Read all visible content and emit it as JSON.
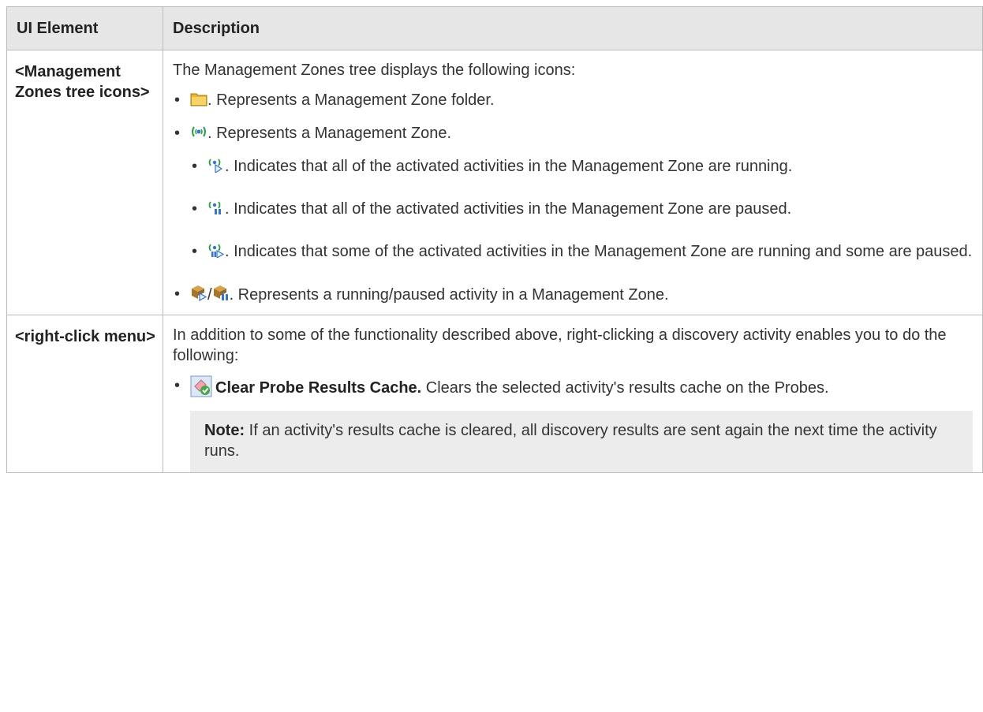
{
  "table": {
    "headers": {
      "element": "UI Element",
      "description": "Description"
    },
    "row1": {
      "element": "<Management Zones tree icons>",
      "intro": "The Management Zones tree displays the following icons:",
      "folder_text": ". Represents a Management Zone folder.",
      "zone_text": ". Represents a Management Zone.",
      "running_text": ". Indicates that all of the activated activities in the Management Zone are running.",
      "paused_text": ". Indicates that all of the activated activities in the Management Zone are paused.",
      "mixed_text": ". Indicates that some of the activated activities in the Management Zone are running and some are paused.",
      "activity_separator": "/",
      "activity_text": ". Represents a running/paused activity in a Management Zone."
    },
    "row2": {
      "element": "<right-click menu>",
      "intro": "In addition to some of the functionality described above, right-clicking a discovery activity enables you to do the following:",
      "clear_cache_label": "Clear Probe Results Cache.",
      "clear_cache_text": " Clears the selected activity's results cache on the Probes.",
      "note_label": "Note:",
      "note_text": " If an activity's results cache is cleared, all discovery results are sent again the next time the activity runs."
    }
  },
  "icons": {
    "folder": "folder-icon",
    "zone": "management-zone-icon",
    "zone_running": "zone-running-icon",
    "zone_paused": "zone-paused-icon",
    "zone_mixed": "zone-mixed-icon",
    "activity_running": "activity-running-icon",
    "activity_paused": "activity-paused-icon",
    "clear_cache": "clear-cache-icon"
  },
  "colors": {
    "header_bg": "#e6e6e6",
    "border": "#bbbbbb",
    "note_bg": "#ececec",
    "text": "#333333",
    "zone_signal": "#2a9d4a",
    "zone_core": "#3b74c4"
  }
}
